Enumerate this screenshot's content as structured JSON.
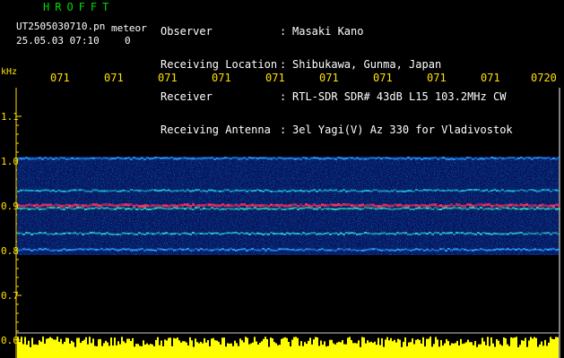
{
  "header": {
    "brand": "HROFFT",
    "filename": "UT2505030710.pn",
    "mode": "meteor",
    "datetime": "25.05.03 07:10",
    "count": "0",
    "info": [
      {
        "label": "Observer",
        "value": "Masaki Kano"
      },
      {
        "label": "Receiving Location",
        "value": "Shibukawa, Gunma, Japan"
      },
      {
        "label": "Receiver",
        "value": "RTL-SDR SDR# 43dB L15 103.2MHz CW"
      },
      {
        "label": "Receiving Antenna",
        "value": "3el Yagi(V) Az 330 for Vladivostok"
      }
    ]
  },
  "axes": {
    "y_unit": "kHz",
    "y_ticks": [
      "1.1",
      "1.0",
      "0.9",
      "0.8",
      "0.7",
      "0.6"
    ],
    "x_ticks": [
      "071",
      "071",
      "071",
      "071",
      "071",
      "071",
      "071",
      "071",
      "071",
      "0720"
    ]
  },
  "colors": {
    "text_primary": "#ffffff",
    "brand": "#00d800",
    "axis": "#ffe000",
    "background": "#000000"
  }
}
